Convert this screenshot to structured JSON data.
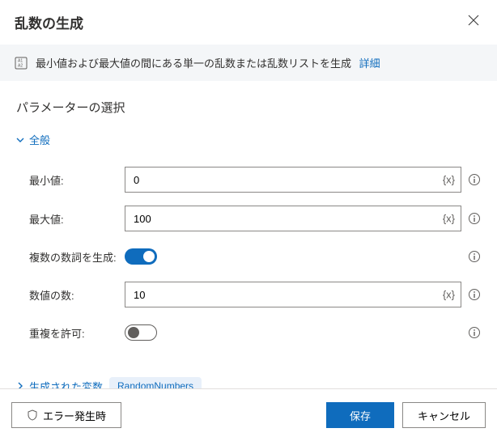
{
  "header": {
    "title": "乱数の生成"
  },
  "description": {
    "text": "最小値および最大値の間にある単一の乱数または乱数リストを生成",
    "details_label": "詳細"
  },
  "section": {
    "title": "パラメーターの選択"
  },
  "group_general": {
    "label": "全般"
  },
  "fields": {
    "min": {
      "label": "最小値:",
      "value": "0",
      "var_badge": "{x}"
    },
    "max": {
      "label": "最大値:",
      "value": "100",
      "var_badge": "{x}"
    },
    "gen_multiple": {
      "label": "複数の数詞を生成:"
    },
    "count": {
      "label": "数値の数:",
      "value": "10",
      "var_badge": "{x}"
    },
    "allow_dup": {
      "label": "重複を許可:"
    }
  },
  "generated_vars": {
    "label": "生成された変数",
    "chip": "RandomNumbers"
  },
  "footer": {
    "on_error": "エラー発生時",
    "save": "保存",
    "cancel": "キャンセル"
  }
}
